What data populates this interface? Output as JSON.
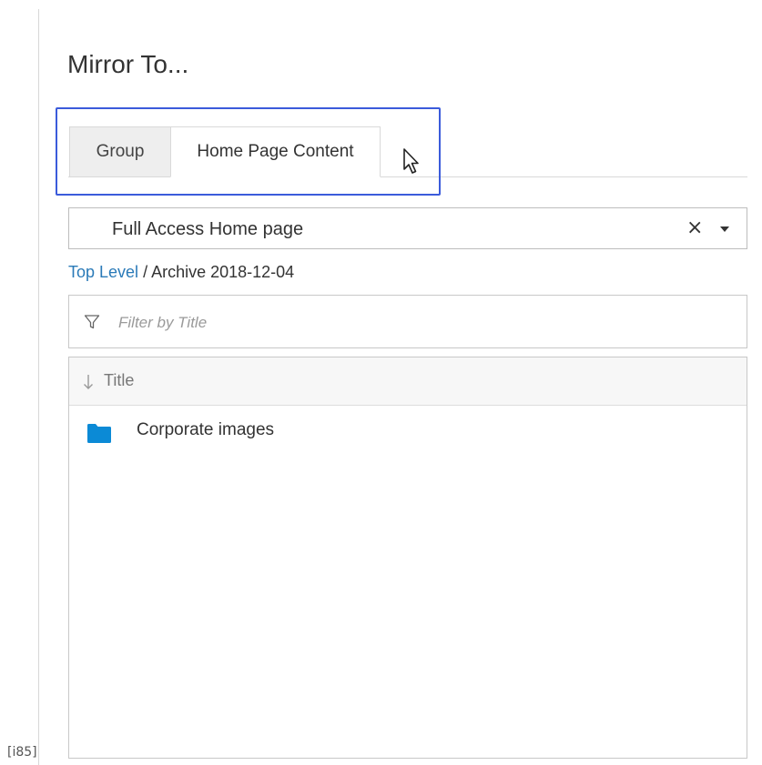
{
  "dialog": {
    "title": "Mirror To..."
  },
  "tabs": [
    {
      "label": "Group",
      "active": false
    },
    {
      "label": "Home Page Content",
      "active": true
    }
  ],
  "select": {
    "value": "Full Access Home page",
    "clear_symbol": "×"
  },
  "breadcrumb": {
    "root": "Top Level",
    "separator": " / ",
    "current": "Archive 2018-12-04"
  },
  "filter": {
    "placeholder": "Filter by Title",
    "value": ""
  },
  "list": {
    "column_header": "Title",
    "items": [
      {
        "label": "Corporate images",
        "icon": "folder-icon"
      }
    ]
  },
  "corner_label": "[i85]",
  "colors": {
    "highlight": "#3b5bdb",
    "link": "#2a7ab8",
    "folder": "#0b8ad6"
  }
}
